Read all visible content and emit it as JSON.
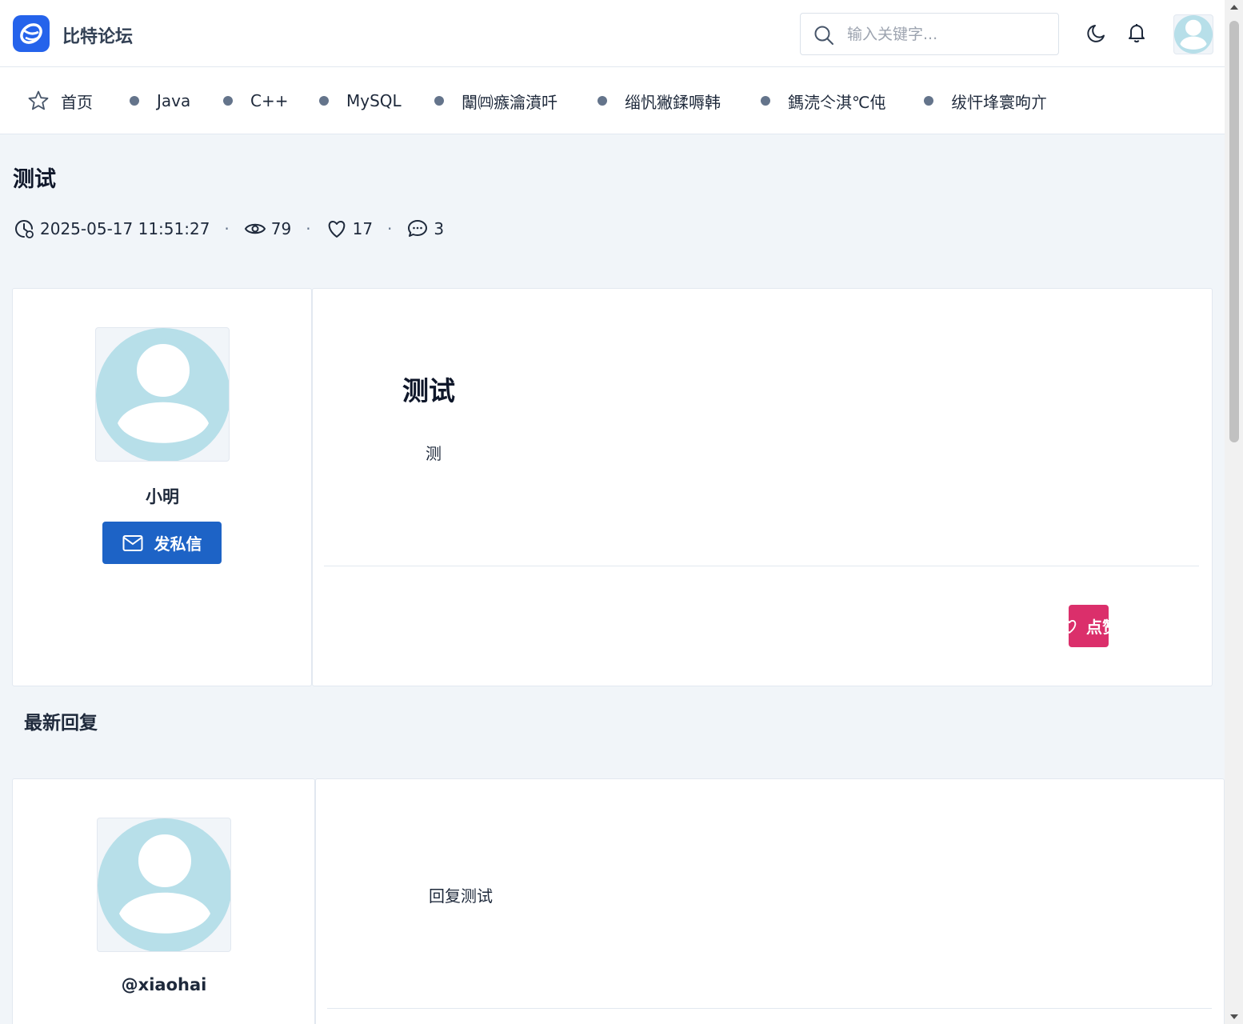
{
  "header": {
    "brand": "比特论坛",
    "search_placeholder": "输入关键字..."
  },
  "nav": {
    "items": [
      {
        "label": "首页"
      },
      {
        "label": "Java"
      },
      {
        "label": "C++"
      },
      {
        "label": "MySQL"
      },
      {
        "label": "闈㈣瘯瀹濆吀"
      },
      {
        "label": "缁忛獙鍒嗕韩"
      },
      {
        "label": "鎷涜仒淇℃伅"
      },
      {
        "label": "绂忓埄寰呴亣"
      }
    ]
  },
  "post": {
    "title": "测试",
    "time": "2025-05-17 11:51:27",
    "views": "79",
    "likes": "17",
    "comments": "3",
    "separator": "·",
    "author": "小明",
    "pm_label": "发私信",
    "content_title": "测试",
    "content_text": "测",
    "like_label": "点赞"
  },
  "replies": {
    "section_title": "最新回复",
    "items": [
      {
        "author": "@xiaohai",
        "text": "回复测试"
      }
    ]
  },
  "colors": {
    "primary": "#1d63c6",
    "like": "#db2f6b",
    "avatar": "#b7dfe9"
  }
}
